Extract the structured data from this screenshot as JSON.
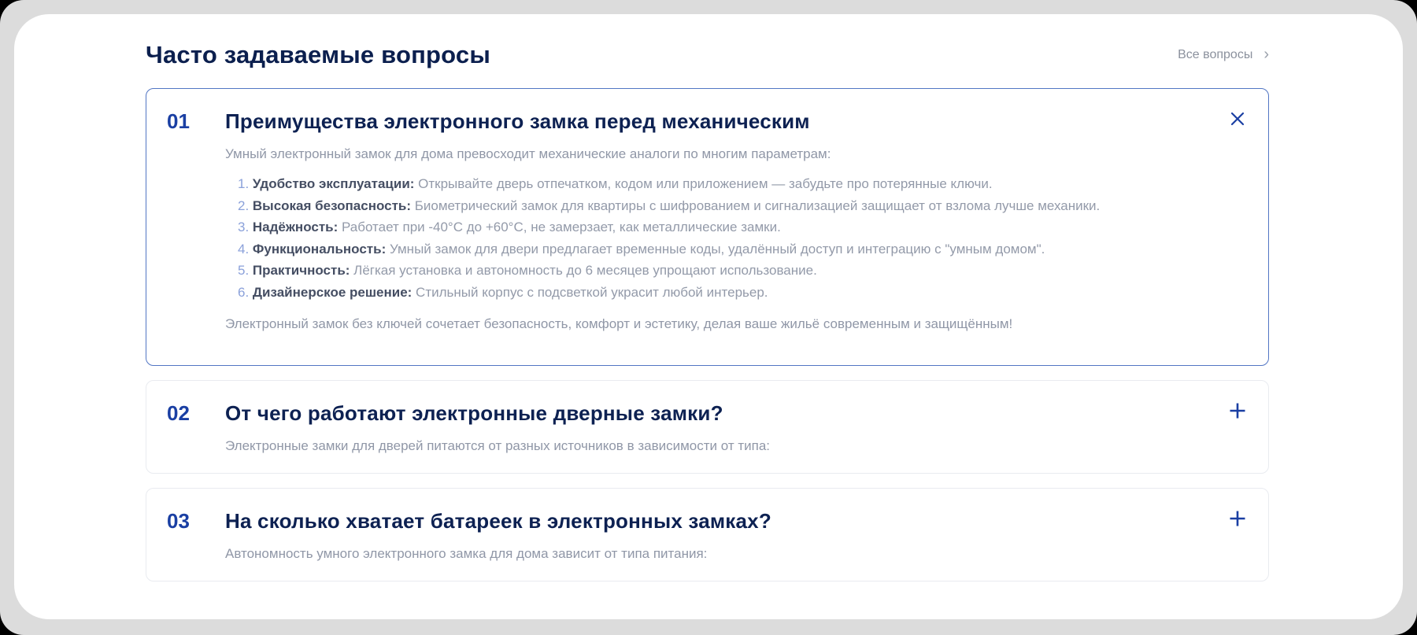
{
  "colors": {
    "outer_bg": "#000000",
    "page_bg": "#dcdcdc",
    "card_bg": "#ffffff",
    "title_navy": "#0b1f4e",
    "accent_blue": "#1a3fa3",
    "expanded_border": "#5276c4",
    "collapsed_border": "#e9ebf0",
    "muted_text": "#9097a7",
    "list_number": "#8ba1da",
    "list_label": "#454e63",
    "link_gray": "#8b919d"
  },
  "header": {
    "title": "Часто задаваемые вопросы",
    "all_questions_label": "Все вопросы",
    "chevron": "›"
  },
  "faq": {
    "items": [
      {
        "number": "01",
        "question": "Преимущества электронного замка перед механическим",
        "expanded": true,
        "toggle_icon": "close-icon",
        "intro": "Умный электронный замок для дома превосходит механические аналоги по многим параметрам:",
        "list": [
          {
            "n": "1.",
            "label": "Удобство эксплуатации:",
            "text": "Открывайте дверь отпечатком, кодом или приложением — забудьте про потерянные ключи."
          },
          {
            "n": "2.",
            "label": "Высокая безопасность:",
            "text": "Биометрический замок для квартиры с шифрованием и сигнализацией защищает от взлома лучше механики."
          },
          {
            "n": "3.",
            "label": "Надёжность:",
            "text": "Работает при -40°С до +60°С, не замерзает, как металлические замки."
          },
          {
            "n": "4.",
            "label": "Функциональность:",
            "text": "Умный замок для двери предлагает временные коды, удалённый доступ и интеграцию с \"умным домом\"."
          },
          {
            "n": "5.",
            "label": "Практичность:",
            "text": "Лёгкая установка и автономность до 6 месяцев упрощают использование."
          },
          {
            "n": "6.",
            "label": "Дизайнерское решение:",
            "text": "Стильный корпус с подсветкой украсит любой интерьер."
          }
        ],
        "outro": "Электронный замок без ключей сочетает безопасность, комфорт и эстетику, делая ваше жильё современным и защищённым!"
      },
      {
        "number": "02",
        "question": "От чего работают электронные дверные замки?",
        "expanded": false,
        "toggle_icon": "plus-icon",
        "intro": "Электронные замки для дверей питаются от разных источников в зависимости от типа:"
      },
      {
        "number": "03",
        "question": "На сколько хватает батареек в электронных замках?",
        "expanded": false,
        "toggle_icon": "plus-icon",
        "intro": "Автономность умного электронного замка для дома зависит от типа питания:"
      }
    ]
  }
}
